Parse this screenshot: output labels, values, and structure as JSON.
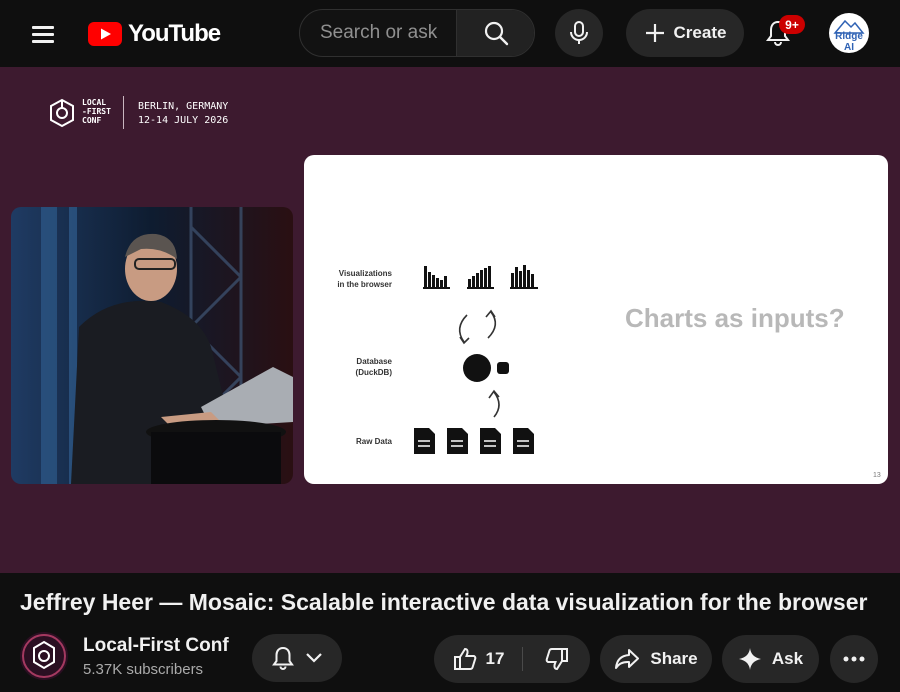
{
  "header": {
    "logo_text": "YouTube",
    "search_placeholder": "Search or ask",
    "create_label": "Create",
    "notifications_badge": "9+",
    "account_avatar_text": "Ridge AI"
  },
  "video": {
    "overlay": {
      "conference_name": "LOCAL\n-FIRST\nCONF",
      "location": "BERLIN, GERMANY",
      "dates": "12-14 JULY 2026"
    },
    "slide": {
      "labels": [
        "Visualizations\nin the browser",
        "Database\n(DuckDB)",
        "Raw Data"
      ],
      "headline": "Charts as inputs?",
      "page_number": "13"
    }
  },
  "title": "Jeffrey Heer — Mosaic: Scalable interactive data visualization for the browser",
  "channel": {
    "name": "Local-First Conf",
    "subscribers": "5.37K subscribers"
  },
  "actions": {
    "like_count": "17",
    "share_label": "Share",
    "ask_label": "Ask"
  },
  "colors": {
    "video_background": "#3d1a2f",
    "page_background": "#0f0f0f",
    "button_background": "#272727",
    "brand_red": "#ff0000",
    "badge_red": "#cc0000"
  },
  "icons": [
    "menu-icon",
    "youtube-logo-icon",
    "search-icon",
    "mic-icon",
    "plus-icon",
    "bell-icon",
    "chevron-down-icon",
    "thumbs-up-icon",
    "thumbs-down-icon",
    "share-icon",
    "sparkle-icon",
    "more-icon"
  ]
}
